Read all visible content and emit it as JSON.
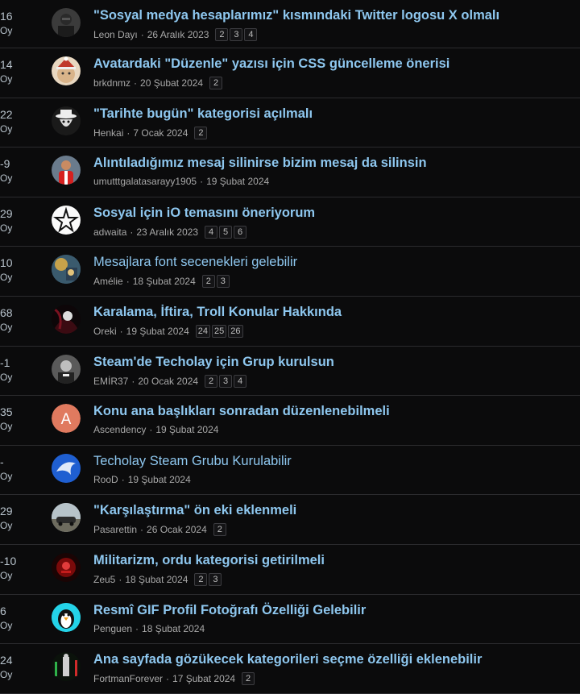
{
  "vote_label": "Oy",
  "topics": [
    {
      "score": "16",
      "title": "\"Sosyal medya hesaplarımız\" kısmındaki Twitter logosu X olmalı",
      "bold": true,
      "author": "Leon Dayı",
      "date": "26 Aralık 2023",
      "pages": [
        "2",
        "3",
        "4"
      ],
      "avatar": "leon"
    },
    {
      "score": "14",
      "title": "Avatardaki \"Düzenle\" yazısı için CSS güncelleme önerisi",
      "bold": true,
      "author": "brkdnmz",
      "date": "20 Şubat 2024",
      "pages": [
        "2"
      ],
      "avatar": "cat"
    },
    {
      "score": "22",
      "title": "\"Tarihte bugün\" kategorisi açılmalı",
      "bold": true,
      "author": "Henkai",
      "date": "7 Ocak 2024",
      "pages": [
        "2"
      ],
      "avatar": "hat"
    },
    {
      "score": "-9",
      "title": "Alıntıladığımız mesaj silinirse bizim mesaj da silinsin",
      "bold": true,
      "author": "umutttgalatasarayy1905",
      "date": "19 Şubat 2024",
      "pages": [],
      "avatar": "player"
    },
    {
      "score": "29",
      "title": "Sosyal için iO temasını öneriyorum",
      "bold": true,
      "author": "adwaita",
      "date": "23 Aralık 2023",
      "pages": [
        "4",
        "5",
        "6"
      ],
      "avatar": "star"
    },
    {
      "score": "10",
      "title": "Mesajlara font secenekleri gelebilir",
      "bold": false,
      "author": "Amélie",
      "date": "18 Şubat 2024",
      "pages": [
        "2",
        "3"
      ],
      "avatar": "art"
    },
    {
      "score": "68",
      "title": "Karalama, İftira, Troll Konular Hakkında",
      "bold": true,
      "author": "Oreki",
      "date": "19 Şubat 2024",
      "pages": [
        "24",
        "25",
        "26"
      ],
      "avatar": "dark"
    },
    {
      "score": "-1",
      "title": "Steam'de Techolay için Grup kurulsun",
      "bold": true,
      "author": "EMİR37",
      "date": "20 Ocak 2024",
      "pages": [
        "2",
        "3",
        "4"
      ],
      "avatar": "portrait"
    },
    {
      "score": "35",
      "title": "Konu ana başlıkları sonradan düzenlenebilmeli",
      "bold": true,
      "author": "Ascendency",
      "date": "19 Şubat 2024",
      "pages": [],
      "avatar": "letter",
      "avatar_letter": "A",
      "avatar_color": "#e07a5f"
    },
    {
      "score": "-",
      "title": "Techolay Steam Grubu Kurulabilir",
      "bold": false,
      "author": "RooD",
      "date": "19 Şubat 2024",
      "pages": [],
      "avatar": "dolphin"
    },
    {
      "score": "29",
      "title": "\"Karşılaştırma\" ön eki eklenmeli",
      "bold": true,
      "author": "Pasarettin",
      "date": "26 Ocak 2024",
      "pages": [
        "2"
      ],
      "avatar": "car"
    },
    {
      "score": "-10",
      "title": "Militarizm, ordu kategorisi getirilmeli",
      "bold": true,
      "author": "Zeu5",
      "date": "18 Şubat 2024",
      "pages": [
        "2",
        "3"
      ],
      "avatar": "red"
    },
    {
      "score": "6",
      "title": "Resmî GIF Profil Fotoğrafı Özelliği Gelebilir",
      "bold": true,
      "author": "Penguen",
      "date": "18 Şubat 2024",
      "pages": [],
      "avatar": "penguin"
    },
    {
      "score": "24",
      "title": "Ana sayfada gözükecek kategorileri seçme özelliği eklenebilir",
      "bold": true,
      "author": "FortmanForever",
      "date": "17 Şubat 2024",
      "pages": [
        "2"
      ],
      "avatar": "figure"
    }
  ]
}
